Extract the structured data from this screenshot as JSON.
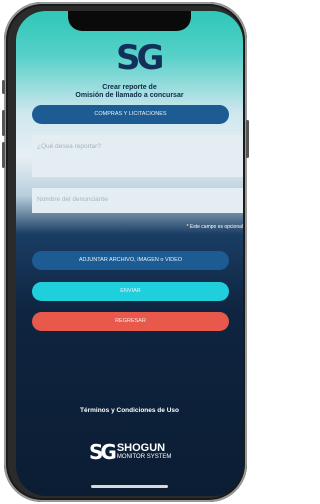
{
  "header": {
    "logo_text": "SG",
    "title_line1": "Crear reporte de",
    "title_line2": "Omisión de llamado a concursar"
  },
  "category_button": {
    "label": "COMPRAS Y LICITACIONES"
  },
  "report_field": {
    "placeholder": "¿Qué desea reportar?"
  },
  "name_field": {
    "placeholder": "Nombre del denunciante"
  },
  "optional_note": "* Este campo es opcional",
  "attach_button": {
    "label": "ADJUNTAR ARCHIVO, IMAGEN o VIDEO"
  },
  "send_button": {
    "label": "ENVIAR"
  },
  "back_button": {
    "label": "REGRESAR"
  },
  "footer": {
    "terms_link": "Términos y Condiciones de Uso",
    "brand_mark": "SG",
    "brand_name": "SHOGUN",
    "brand_sub": "MONITOR SYSTEM"
  },
  "colors": {
    "primary": "#1d5b93",
    "send": "#1fd0dc",
    "back": "#e8584b"
  }
}
